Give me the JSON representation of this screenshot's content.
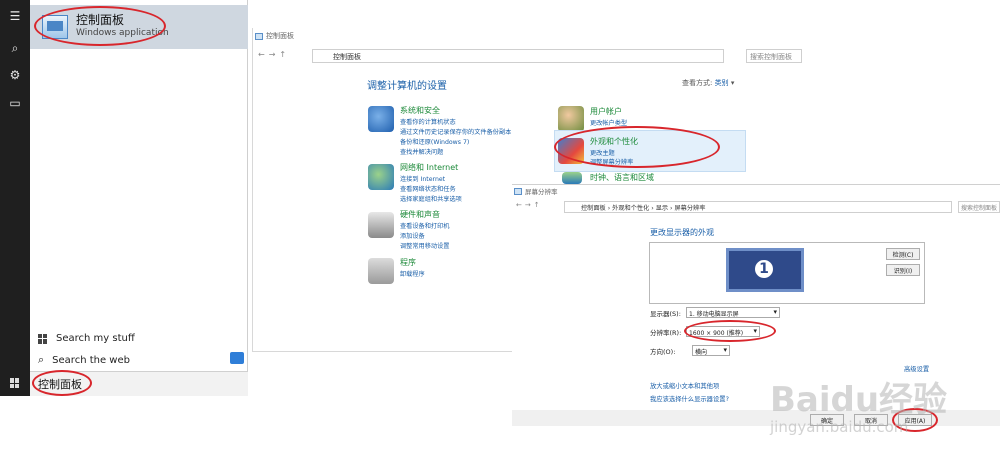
{
  "start_menu": {
    "best_match": {
      "title": "控制面板",
      "subtitle": "Windows application"
    },
    "search_my_stuff": "Search my stuff",
    "search_the_web": "Search the web",
    "search_query": "控制面板"
  },
  "control_panel": {
    "window_title": "控制面板",
    "address": "控制面板",
    "search_placeholder": "搜索控制面板",
    "heading": "调整计算机的设置",
    "view_by_label": "查看方式:",
    "view_by_value": "类别",
    "categories": [
      {
        "title": "系统和安全",
        "links": [
          "查看你的计算机状态",
          "通过文件历史记录保存你的文件备份副本",
          "备份和还原(Windows 7)",
          "查找并解决问题"
        ]
      },
      {
        "title": "网络和 Internet",
        "links": [
          "连接到 Internet",
          "查看网络状态和任务",
          "选择家庭组和共享选项"
        ]
      },
      {
        "title": "硬件和声音",
        "links": [
          "查看设备和打印机",
          "添加设备",
          "调整常用移动设置"
        ]
      },
      {
        "title": "程序",
        "links": [
          "卸载程序"
        ]
      },
      {
        "title": "用户帐户",
        "links": [
          "更改帐户类型"
        ]
      },
      {
        "title": "外观和个性化",
        "links": [
          "更改主题",
          "调整屏幕分辨率"
        ]
      },
      {
        "title": "时钟、语言和区域",
        "links": []
      }
    ]
  },
  "display_settings": {
    "window_title": "屏幕分辨率",
    "breadcrumb": "控制面板  ›  外观和个性化  ›  显示  ›  屏幕分辨率",
    "search_placeholder": "搜索控制面板",
    "heading": "更改显示器的外观",
    "monitor_number": "1",
    "detect_button": "检测(C)",
    "identify_button": "识别(I)",
    "display_label": "显示器(S):",
    "display_value": "1. 移动电脑显示屏",
    "resolution_label": "分辨率(R):",
    "resolution_value": "1600 × 900 (推荐)",
    "orientation_label": "方向(O):",
    "orientation_value": "横向",
    "advanced_link": "高级设置",
    "link_text_size": "放大或缩小文本和其他项",
    "link_choose": "我应该选择什么显示器设置?",
    "ok_button": "确定",
    "cancel_button": "取消",
    "apply_button": "应用(A)"
  },
  "watermark": {
    "logo": "Baidu经验",
    "sub": "jingyan.baidu.com"
  },
  "colors": {
    "annotation": "#d8262c",
    "link": "#1a5fa8",
    "category_title": "#1d8a3a"
  }
}
